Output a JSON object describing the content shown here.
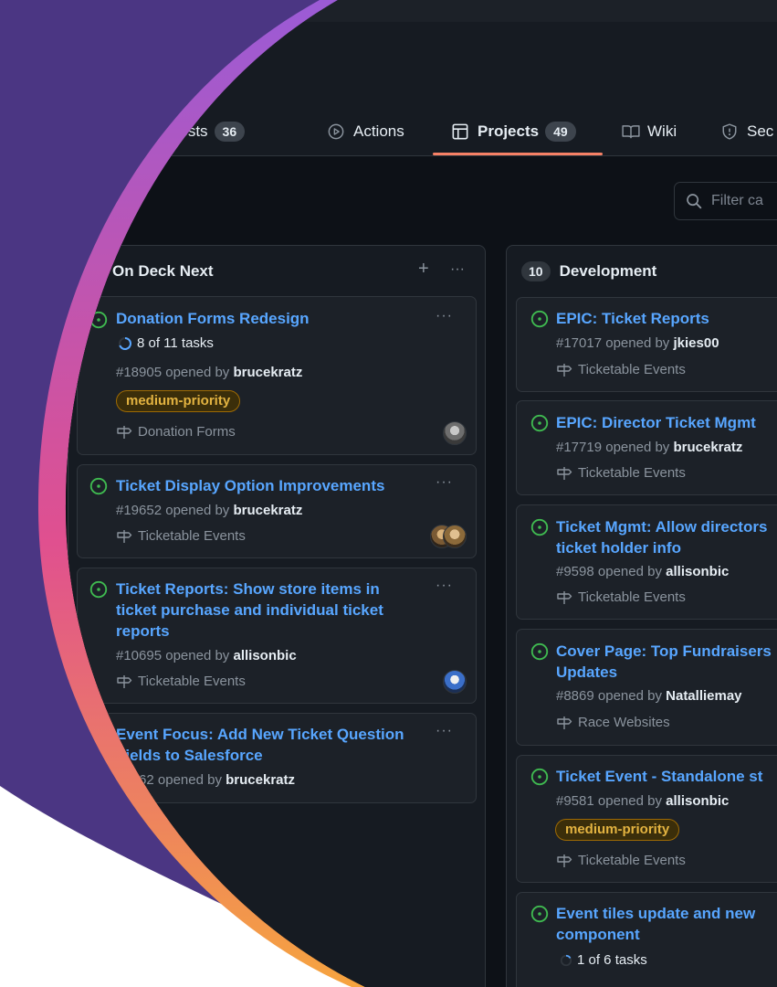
{
  "colors": {
    "background_purple": "#4b3683",
    "ring_top": "#9b5bd6",
    "ring_mid": "#e0508f",
    "ring_bottom": "#f6a43f",
    "link_blue": "#58a6ff",
    "open_green": "#3fb950",
    "label_yellow": "#e3b341",
    "tab_underline": "#f78166"
  },
  "nav": {
    "tabs": [
      {
        "label": "equests",
        "count": "36",
        "icon": "pull-request-icon"
      },
      {
        "label": "Actions",
        "icon": "play-circle-icon"
      },
      {
        "label": "Projects",
        "count": "49",
        "icon": "table-icon",
        "selected": true
      },
      {
        "label": "Wiki",
        "icon": "book-icon"
      },
      {
        "label": "Sec",
        "icon": "shield-icon"
      }
    ]
  },
  "filter": {
    "placeholder": "Filter ca"
  },
  "columns": [
    {
      "count": "",
      "title": "On Deck Next",
      "add_label": "+",
      "more_label": "···",
      "cards": [
        {
          "title_lines": [
            "Donation Forms Redesign"
          ],
          "tasks": "8 of 11 tasks",
          "number": "#18905",
          "opened_by": "opened by",
          "author": "brucekratz",
          "label": "medium-priority",
          "milestone": "Donation Forms"
        },
        {
          "title_lines": [
            "Ticket Display Option Improvements"
          ],
          "number": "#19652",
          "opened_by": "opened by",
          "author": "brucekratz",
          "milestone": "Ticketable Events"
        },
        {
          "title_lines": [
            "Ticket Reports: Show store items in",
            "ticket purchase and individual ticket",
            "reports"
          ],
          "number": "#10695",
          "opened_by": "opened by",
          "author": "allisonbic",
          "milestone": "Ticketable Events"
        },
        {
          "title_lines": [
            "Event Focus: Add New Ticket Question",
            "Fields to Salesforce"
          ],
          "number": "18862",
          "opened_by": "opened by",
          "author": "brucekratz"
        }
      ]
    },
    {
      "count": "10",
      "title": "Development",
      "cards": [
        {
          "title_lines": [
            "EPIC: Ticket Reports"
          ],
          "number": "#17017",
          "opened_by": "opened by",
          "author": "jkies00",
          "milestone": "Ticketable Events"
        },
        {
          "title_lines": [
            "EPIC: Director Ticket Mgmt"
          ],
          "number": "#17719",
          "opened_by": "opened by",
          "author": "brucekratz",
          "milestone": "Ticketable Events"
        },
        {
          "title_lines": [
            "Ticket Mgmt: Allow directors",
            "ticket holder info"
          ],
          "number": "#9598",
          "opened_by": "opened by",
          "author": "allisonbic",
          "milestone": "Ticketable Events"
        },
        {
          "title_lines": [
            "Cover Page: Top Fundraisers",
            "Updates"
          ],
          "number": "#8869",
          "opened_by": "opened by",
          "author": "Natalliemay",
          "milestone": "Race Websites"
        },
        {
          "title_lines": [
            "Ticket Event - Standalone st"
          ],
          "number": "#9581",
          "opened_by": "opened by",
          "author": "allisonbic",
          "label": "medium-priority",
          "milestone": "Ticketable Events"
        },
        {
          "title_lines": [
            "Event tiles update and new",
            "component"
          ],
          "tasks": "1 of 6 tasks"
        }
      ]
    }
  ]
}
